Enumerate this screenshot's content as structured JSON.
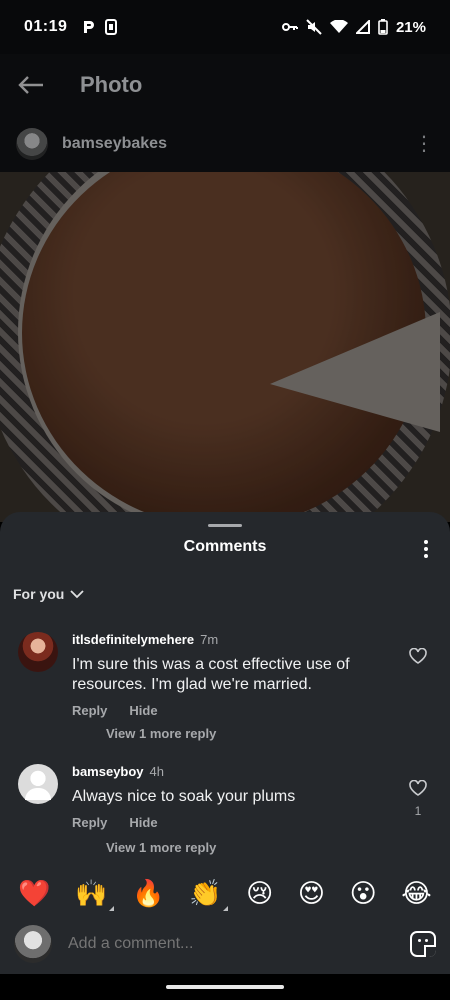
{
  "status_bar": {
    "time": "01:19",
    "battery": "21%",
    "icons": [
      "p-icon",
      "sim-icon",
      "key-icon",
      "mute-icon",
      "wifi-icon",
      "signal-icon",
      "battery-icon"
    ]
  },
  "app_bar": {
    "title": "Photo"
  },
  "post": {
    "username": "bamseybakes"
  },
  "comments_sheet": {
    "title": "Comments",
    "filter_label": "For you",
    "comments": [
      {
        "username": "itlsdefinitelymehere",
        "time": "7m",
        "text": "I'm sure this was a cost effective use of resources. I'm glad we're married.",
        "reply_label": "Reply",
        "hide_label": "Hide",
        "view_more": "View 1 more reply",
        "likes": ""
      },
      {
        "username": "bamseyboy",
        "time": "4h",
        "text": "Always nice to soak your plums",
        "reply_label": "Reply",
        "hide_label": "Hide",
        "view_more": "View 1 more reply",
        "likes": "1"
      }
    ],
    "emojis": [
      "❤️",
      "🙌",
      "🔥",
      "👏",
      "😢",
      "😍",
      "😮",
      "😂"
    ],
    "input_placeholder": "Add a comment..."
  },
  "colors": {
    "sheet_bg": "#25282c",
    "muted_text": "#a7a9ac"
  }
}
